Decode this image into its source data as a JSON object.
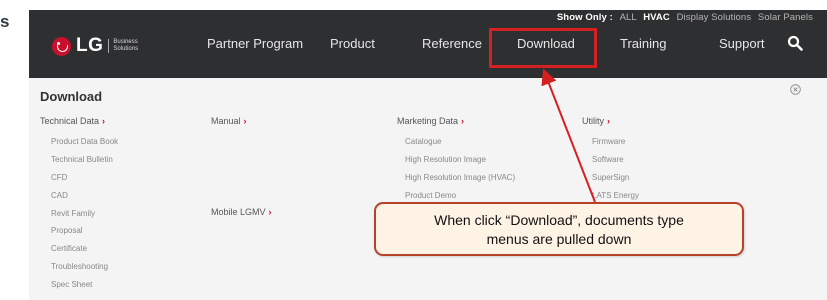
{
  "cut_label": "s",
  "show_only": {
    "label": "Show Only :",
    "options": [
      {
        "label": "ALL",
        "active": false
      },
      {
        "label": "HVAC",
        "active": true
      },
      {
        "label": "Display Solutions",
        "active": false
      },
      {
        "label": "Solar Panels",
        "active": false
      }
    ]
  },
  "logo": {
    "text": "LG",
    "subtitle_line1": "Business",
    "subtitle_line2": "Solutions"
  },
  "nav": {
    "items": [
      "Partner Program",
      "Product",
      "Reference",
      "Download",
      "Training",
      "Support"
    ],
    "highlighted": "Download",
    "search_icon": "search-icon"
  },
  "menu": {
    "title": "Download",
    "close_icon": "close-circle-icon",
    "columns": {
      "technical_data": {
        "label": "Technical Data",
        "items": [
          "Product Data Book",
          "Technical Bulletin",
          "CFD",
          "CAD",
          "Revit Family",
          "Proposal",
          "Certificate",
          "Troubleshooting",
          "Spec Sheet"
        ]
      },
      "manual": {
        "label": "Manual"
      },
      "mobile_lgmv": {
        "label": "Mobile LGMV"
      },
      "marketing_data": {
        "label": "Marketing Data",
        "items": [
          "Catalogue",
          "High Resolution Image",
          "High Resolution Image (HVAC)",
          "Product Demo"
        ]
      },
      "utility": {
        "label": "Utility",
        "items": [
          "Firmware",
          "Software",
          "SuperSign",
          "LATS Energy"
        ]
      }
    },
    "arrow_glyph": "›"
  },
  "callout": {
    "line1": "When click “Download”, documents type",
    "line2": "menus are pulled down"
  },
  "colors": {
    "accent_red": "#c8102e",
    "annotation_red": "#d42020",
    "header_bg": "#2e2f31"
  }
}
